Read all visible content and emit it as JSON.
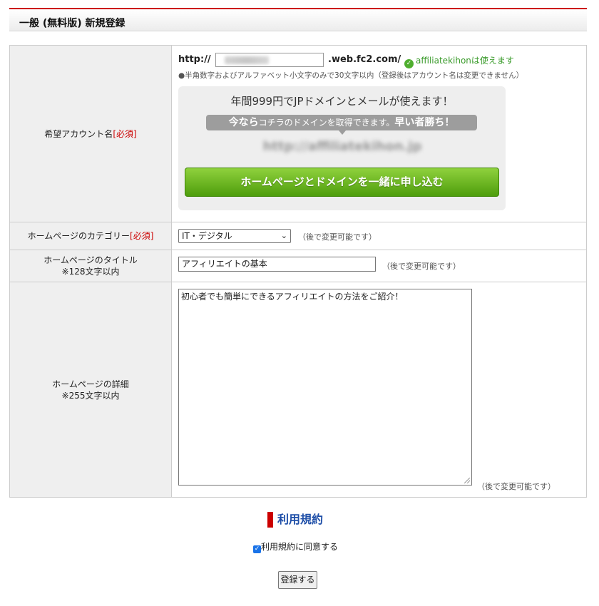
{
  "header": {
    "title": "一般 (無料版) 新規登録"
  },
  "account": {
    "label": "希望アカウント名",
    "required": "[必須]",
    "url_prefix": "http://",
    "url_suffix": ".web.fc2.com/",
    "available": "affiliatekihonは使えます",
    "note": "●半角数字およびアルファベット小文字のみで30文字以内（登録後はアカウント名は変更できません）"
  },
  "promo": {
    "title": "年間999円でJPドメインとメールが使えます！",
    "bubble_strong1": "今なら",
    "bubble_text": "コチラのドメインを取得できます。",
    "bubble_strong2": "早い者勝ち！",
    "blurred_domain": "http://affiliatekihon.jp",
    "button": "ホームページとドメインを一緒に申し込む"
  },
  "category": {
    "label": "ホームページのカテゴリー",
    "required": "[必須]",
    "value": "IT・デジタル",
    "hint": "（後で変更可能です）"
  },
  "title": {
    "label": "ホームページのタイトル",
    "sublabel": "※128文字以内",
    "value": "アフィリエイトの基本",
    "hint": "（後で変更可能です）"
  },
  "detail": {
    "label": "ホームページの詳細",
    "sublabel": "※255文字以内",
    "value": "初心者でも簡単にできるアフィリエイトの方法をご紹介！",
    "hint": "（後で変更可能です）"
  },
  "terms": {
    "heading": "利用規約",
    "agree": "利用規約に同意する",
    "checked": true
  },
  "submit": {
    "label": "登録する"
  },
  "colors": {
    "accent_red": "#cc0000",
    "heading_blue": "#1f4fa8",
    "button_green": "#5fb01a",
    "ok_green": "#3a9b2b"
  }
}
